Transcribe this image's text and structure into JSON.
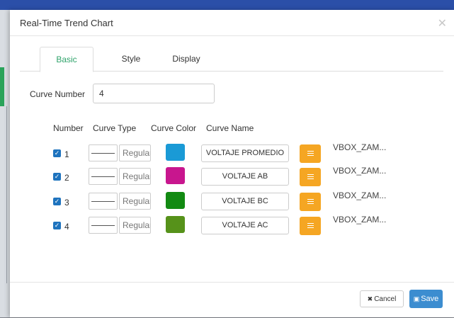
{
  "dialog": {
    "title": "Real-Time Trend Chart"
  },
  "tabs": [
    {
      "label": "Basic",
      "active": true
    },
    {
      "label": "Style",
      "active": false
    },
    {
      "label": "Display",
      "active": false
    }
  ],
  "curve_number": {
    "label": "Curve Number",
    "value": "4"
  },
  "table": {
    "headers": {
      "number": "Number",
      "curve_type": "Curve Type",
      "curve_color": "Curve Color",
      "curve_name": "Curve Name"
    },
    "rows": [
      {
        "checked": true,
        "number": "1",
        "type": "Regular",
        "color": "#1a9ad6",
        "name": "VOLTAJE PROMEDIO",
        "source": "VBOX_ZAM..."
      },
      {
        "checked": true,
        "number": "2",
        "type": "Regular",
        "color": "#c8168e",
        "name": "VOLTAJE AB",
        "source": "VBOX_ZAM..."
      },
      {
        "checked": true,
        "number": "3",
        "type": "Regular",
        "color": "#128a12",
        "name": "VOLTAJE BC",
        "source": "VBOX_ZAM..."
      },
      {
        "checked": true,
        "number": "4",
        "type": "Regular",
        "color": "#56921a",
        "name": "VOLTAJE AC",
        "source": "VBOX_ZAM..."
      }
    ]
  },
  "footer": {
    "cancel_label": "Cancel",
    "save_label": "Save"
  },
  "colors": {
    "accent": "#3c8dd0",
    "active_tab": "#2fa36b",
    "menu_button": "#f5a623"
  },
  "icons": {
    "close": "close-icon",
    "cancel": "x-icon",
    "save": "floppy-icon",
    "menu": "hamburger-icon"
  }
}
